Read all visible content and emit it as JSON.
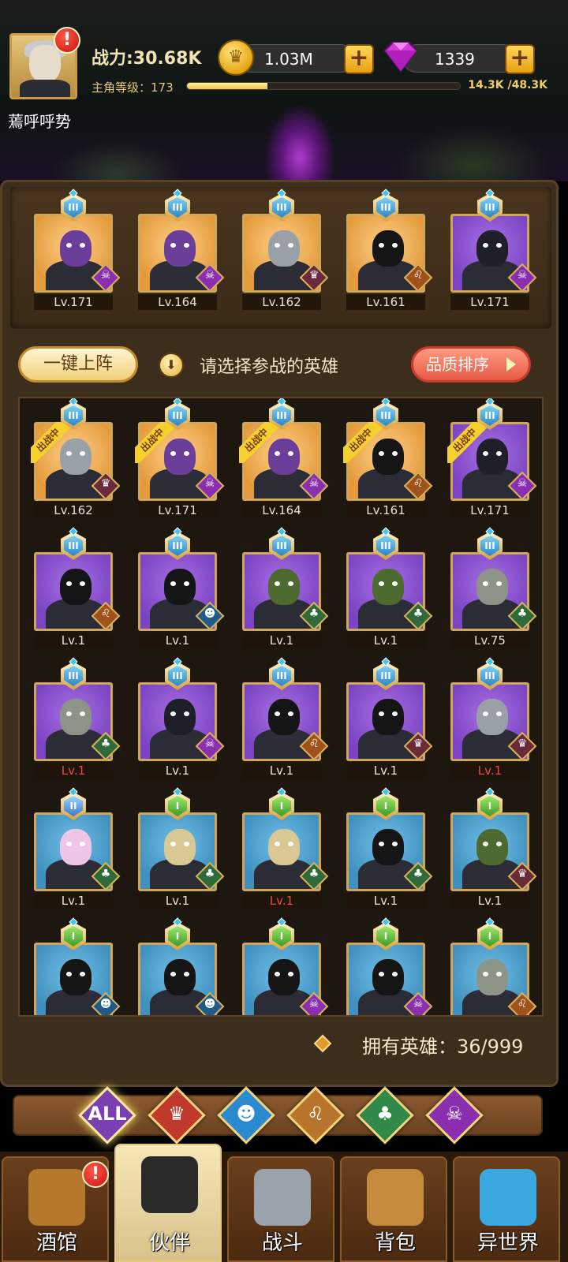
{
  "header": {
    "power_label": "战力:30.68K",
    "level_label": "主角等级：173",
    "exp_text": "14.3K /48.3K",
    "exp_progress": 0.296,
    "gold": "1.03M",
    "gems": "1339",
    "player_name": "蔫呼呼势",
    "alert": "!"
  },
  "team": [
    {
      "rank": "III",
      "level": "Lv.171",
      "bg": "gold",
      "head": "c-purple",
      "faction": "demon"
    },
    {
      "rank": "III",
      "level": "Lv.164",
      "bg": "gold",
      "head": "c-purple",
      "faction": "demon"
    },
    {
      "rank": "III",
      "level": "Lv.162",
      "bg": "gold",
      "head": "c-helmet",
      "faction": "order"
    },
    {
      "rank": "III",
      "level": "Lv.161",
      "bg": "gold",
      "head": "c-black",
      "faction": "beast"
    },
    {
      "rank": "III",
      "level": "Lv.171",
      "bg": "purple",
      "head": "c-skull",
      "faction": "demon"
    }
  ],
  "controls": {
    "quick_deploy": "一键上阵",
    "hint": "请选择参战的英雄",
    "sort": "品质排序"
  },
  "roster": [
    {
      "rank": "III",
      "level": "Lv.162",
      "bg": "gold",
      "head": "c-helmet",
      "faction": "order",
      "deployed": true,
      "deploy_label": "出战中"
    },
    {
      "rank": "III",
      "level": "Lv.171",
      "bg": "gold",
      "head": "c-purple",
      "faction": "demon",
      "deployed": true,
      "deploy_label": "出战中"
    },
    {
      "rank": "III",
      "level": "Lv.164",
      "bg": "gold",
      "head": "c-purple",
      "faction": "demon",
      "deployed": true,
      "deploy_label": "出战中"
    },
    {
      "rank": "III",
      "level": "Lv.161",
      "bg": "gold",
      "head": "c-black",
      "faction": "beast",
      "deployed": true,
      "deploy_label": "出战中"
    },
    {
      "rank": "III",
      "level": "Lv.171",
      "bg": "purple",
      "head": "c-skull",
      "faction": "demon",
      "deployed": true,
      "deploy_label": "出战中"
    },
    {
      "rank": "III",
      "level": "Lv.1",
      "bg": "purple",
      "head": "c-black",
      "faction": "beast"
    },
    {
      "rank": "III",
      "level": "Lv.1",
      "bg": "purple",
      "head": "c-black",
      "faction": "sea"
    },
    {
      "rank": "III",
      "level": "Lv.1",
      "bg": "purple",
      "head": "c-green",
      "faction": "elf"
    },
    {
      "rank": "III",
      "level": "Lv.1",
      "bg": "purple",
      "head": "c-green",
      "faction": "elf"
    },
    {
      "rank": "III",
      "level": "Lv.75",
      "bg": "purple",
      "head": "c-stone",
      "faction": "elf"
    },
    {
      "rank": "III",
      "level": "Lv.1",
      "bg": "purple",
      "head": "c-stone",
      "faction": "elf",
      "red": true
    },
    {
      "rank": "III",
      "level": "Lv.1",
      "bg": "purple",
      "head": "c-skull",
      "faction": "demon"
    },
    {
      "rank": "III",
      "level": "Lv.1",
      "bg": "purple",
      "head": "c-black",
      "faction": "beast"
    },
    {
      "rank": "III",
      "level": "Lv.1",
      "bg": "purple",
      "head": "c-black",
      "faction": "order"
    },
    {
      "rank": "III",
      "level": "Lv.1",
      "bg": "purple",
      "head": "c-helmet",
      "faction": "order",
      "red": true
    },
    {
      "rank": "II",
      "level": "Lv.1",
      "bg": "blue",
      "head": "c-pink",
      "faction": "elf"
    },
    {
      "rank": "I",
      "level": "Lv.1",
      "bg": "blue",
      "head": "c-blond",
      "faction": "elf"
    },
    {
      "rank": "I",
      "level": "Lv.1",
      "bg": "blue",
      "head": "c-blond",
      "faction": "elf",
      "red": true
    },
    {
      "rank": "I",
      "level": "Lv.1",
      "bg": "blue",
      "head": "c-black",
      "faction": "elf"
    },
    {
      "rank": "I",
      "level": "Lv.1",
      "bg": "blue",
      "head": "c-green",
      "faction": "order"
    },
    {
      "rank": "I",
      "level": "",
      "bg": "blue",
      "head": "c-black",
      "faction": "sea"
    },
    {
      "rank": "I",
      "level": "",
      "bg": "blue",
      "head": "c-black",
      "faction": "sea"
    },
    {
      "rank": "I",
      "level": "",
      "bg": "blue",
      "head": "c-black",
      "faction": "demon"
    },
    {
      "rank": "I",
      "level": "",
      "bg": "blue",
      "head": "c-black",
      "faction": "demon"
    },
    {
      "rank": "I",
      "level": "",
      "bg": "blue",
      "head": "c-stone",
      "faction": "beast"
    }
  ],
  "owned_heroes": "拥有英雄：36/999",
  "filters": [
    {
      "id": "all",
      "label": "ALL",
      "color": "#7a3fb0",
      "active": true
    },
    {
      "id": "order",
      "label": "♛",
      "color": "#c0392b"
    },
    {
      "id": "sea",
      "label": "☻",
      "color": "#2a8ad0"
    },
    {
      "id": "beast",
      "label": "♌",
      "color": "#b8742a"
    },
    {
      "id": "elf",
      "label": "♣",
      "color": "#2f8a4a"
    },
    {
      "id": "demon",
      "label": "☠",
      "color": "#8a2fb0"
    }
  ],
  "faction_icons": {
    "demon": {
      "glyph": "☠",
      "color": "#8a2fb0"
    },
    "order": {
      "glyph": "♛",
      "color": "#6a2a3a"
    },
    "beast": {
      "glyph": "♌",
      "color": "#a0521a"
    },
    "elf": {
      "glyph": "♣",
      "color": "#2f6a3a"
    },
    "sea": {
      "glyph": "☻",
      "color": "#1e5a8a"
    }
  },
  "nav": [
    {
      "label": "酒馆",
      "icon": "beer-mug-icon",
      "color": "#b5782c",
      "alert": "!"
    },
    {
      "label": "伙伴",
      "icon": "partner-icon",
      "color": "#2a2a2a",
      "active": true
    },
    {
      "label": "战斗",
      "icon": "crossed-swords-icon",
      "color": "#9aa3ab"
    },
    {
      "label": "背包",
      "icon": "backpack-icon",
      "color": "#c68a3c"
    },
    {
      "label": "异世界",
      "icon": "portal-icon",
      "color": "#3aa8e0"
    }
  ]
}
